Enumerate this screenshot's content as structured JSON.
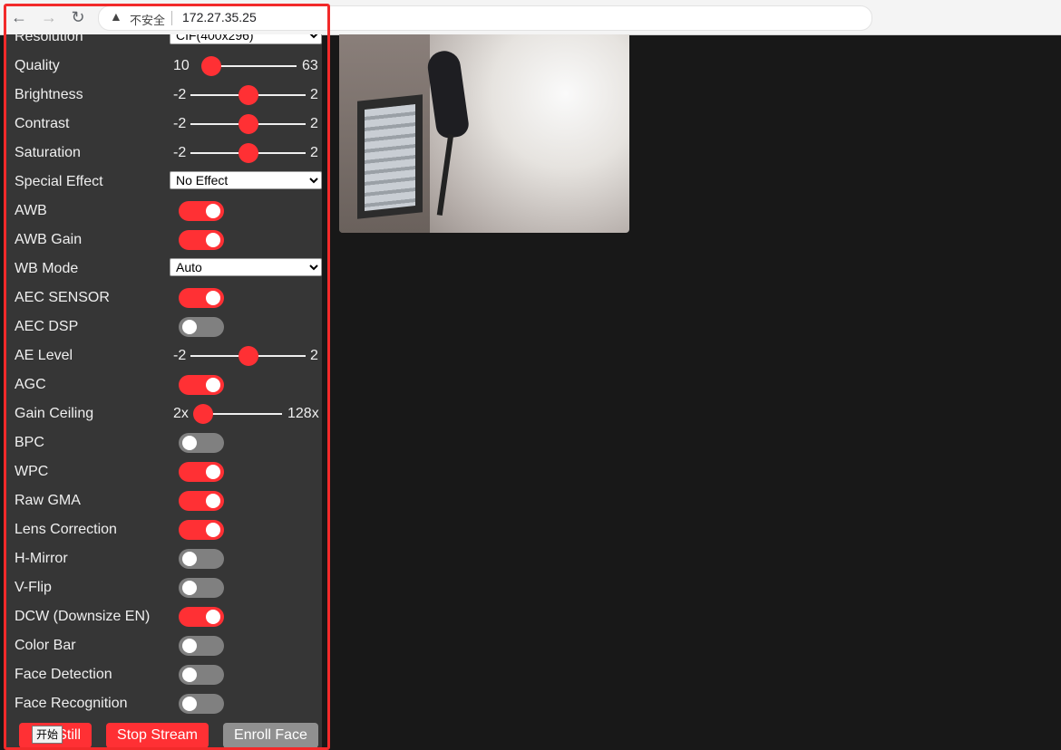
{
  "browser": {
    "warning_icon": "warning-triangle-icon",
    "insecure_label": "不安全",
    "url": "172.27.35.25"
  },
  "controls": {
    "resolution": {
      "label": "Resolution",
      "value": "CIF(400x296)"
    },
    "quality": {
      "label": "Quality",
      "min": "10",
      "max": "63",
      "value": 10
    },
    "brightness": {
      "label": "Brightness",
      "min": "-2",
      "max": "2",
      "value": 0
    },
    "contrast": {
      "label": "Contrast",
      "min": "-2",
      "max": "2",
      "value": 0
    },
    "saturation": {
      "label": "Saturation",
      "min": "-2",
      "max": "2",
      "value": 0
    },
    "special_effect": {
      "label": "Special Effect",
      "value": "No Effect"
    },
    "awb": {
      "label": "AWB",
      "on": true
    },
    "awb_gain": {
      "label": "AWB Gain",
      "on": true
    },
    "wb_mode": {
      "label": "WB Mode",
      "value": "Auto"
    },
    "aec_sensor": {
      "label": "AEC SENSOR",
      "on": true
    },
    "aec_dsp": {
      "label": "AEC DSP",
      "on": false
    },
    "ae_level": {
      "label": "AE Level",
      "min": "-2",
      "max": "2",
      "value": 0
    },
    "agc": {
      "label": "AGC",
      "on": true
    },
    "gain_ceiling": {
      "label": "Gain Ceiling",
      "min": "2x",
      "max": "128x",
      "value": 0
    },
    "bpc": {
      "label": "BPC",
      "on": false
    },
    "wpc": {
      "label": "WPC",
      "on": true
    },
    "raw_gma": {
      "label": "Raw GMA",
      "on": true
    },
    "lens_correction": {
      "label": "Lens Correction",
      "on": true
    },
    "h_mirror": {
      "label": "H-Mirror",
      "on": false
    },
    "v_flip": {
      "label": "V-Flip",
      "on": false
    },
    "dcw": {
      "label": "DCW (Downsize EN)",
      "on": true
    },
    "color_bar": {
      "label": "Color Bar",
      "on": false
    },
    "face_detection": {
      "label": "Face Detection",
      "on": false
    },
    "face_recognition": {
      "label": "Face Recognition",
      "on": false
    }
  },
  "buttons": {
    "get_still": "Still",
    "stop_stream": "Stop Stream",
    "enroll_face": "Enroll Face"
  },
  "tooltip": "开始",
  "colors": {
    "accent": "#ff3034",
    "panel": "#363636",
    "background": "#181818",
    "highlight": "#f22a2a"
  }
}
